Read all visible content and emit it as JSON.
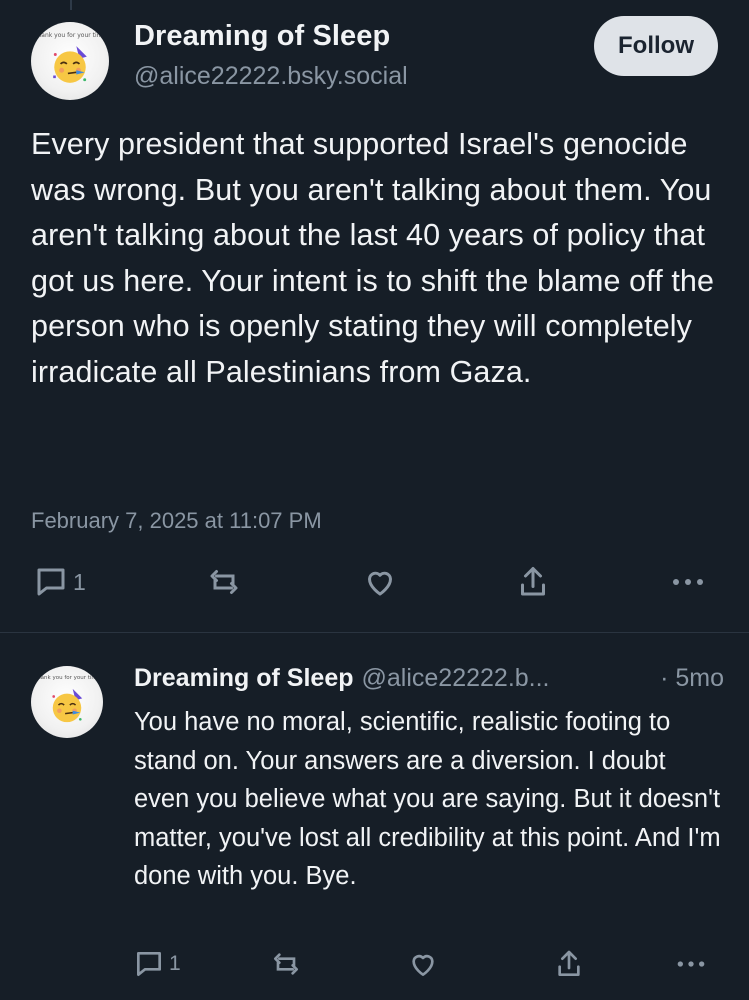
{
  "post": {
    "display_name": "Dreaming of Sleep",
    "handle": "@alice22222.bsky.social",
    "follow_label": "Follow",
    "avatar_caption": "Thank you for your time",
    "avatar_icon": "partying-face-emoji",
    "text": "Every president that supported Israel's genocide was wrong. But you aren't talking about them. You aren't talking about the last 40 years of policy that got us here. Your intent is to shift the blame off the person who is openly stating they will completely irradicate all Palestinians from Gaza.",
    "timestamp": "February 7, 2025 at 11:07 PM",
    "actions": {
      "reply_count": "1",
      "reply_icon": "comment-icon",
      "repost_icon": "repost-icon",
      "like_icon": "heart-icon",
      "share_icon": "share-icon",
      "more_icon": "more-icon"
    }
  },
  "reply": {
    "display_name": "Dreaming of Sleep",
    "handle": "@alice22222.b...",
    "separator": "·",
    "time": "5mo",
    "avatar_caption": "Thank you for your time",
    "text": "You have no moral, scientific, realistic footing to stand on. Your answers are a diversion. I doubt even you believe what you are saying. But it doesn't matter, you've lost all credibility at this point. And I'm done with you. Bye.",
    "actions": {
      "reply_count": "1"
    }
  },
  "colors": {
    "background": "#161e27",
    "text_primary": "#f1f3f5",
    "text_secondary": "#8a96a3",
    "follow_button_bg": "#dfe3e8",
    "divider": "#2a3440"
  }
}
